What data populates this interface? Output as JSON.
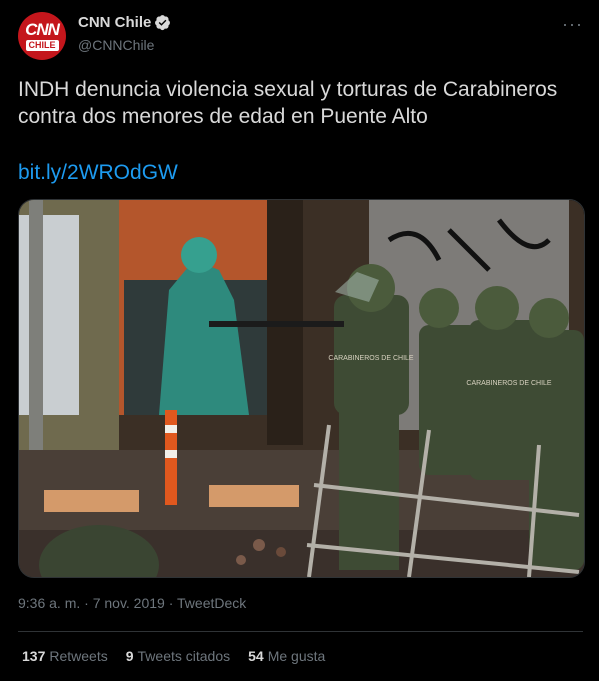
{
  "account": {
    "display_name": "CNN Chile",
    "handle": "@CNNChile",
    "avatar_text_top": "CNN",
    "avatar_text_bottom": "CHILE",
    "verified": true
  },
  "tweet": {
    "text": "INDH denuncia violencia sexual y torturas de Carabineros contra dos menores de edad en Puente Alto",
    "link": "bit.ly/2WROdGW",
    "timestamp": "9:36 a. m. · 7 nov. 2019 · TweetDeck"
  },
  "stats": [
    {
      "count": "137",
      "label": "Retweets"
    },
    {
      "count": "9",
      "label": "Tweets citados"
    },
    {
      "count": "54",
      "label": "Me gusta"
    }
  ],
  "media": {
    "vest_label": "CARABINEROS DE CHILE"
  },
  "colors": {
    "background": "#000000",
    "accent": "#1d9bf0",
    "secondary_text": "#6e767d",
    "primary_text": "#d9d9d9",
    "brand": "#c4161c"
  },
  "icons": {
    "more": "more-options-icon",
    "verified": "verified-badge-icon"
  }
}
